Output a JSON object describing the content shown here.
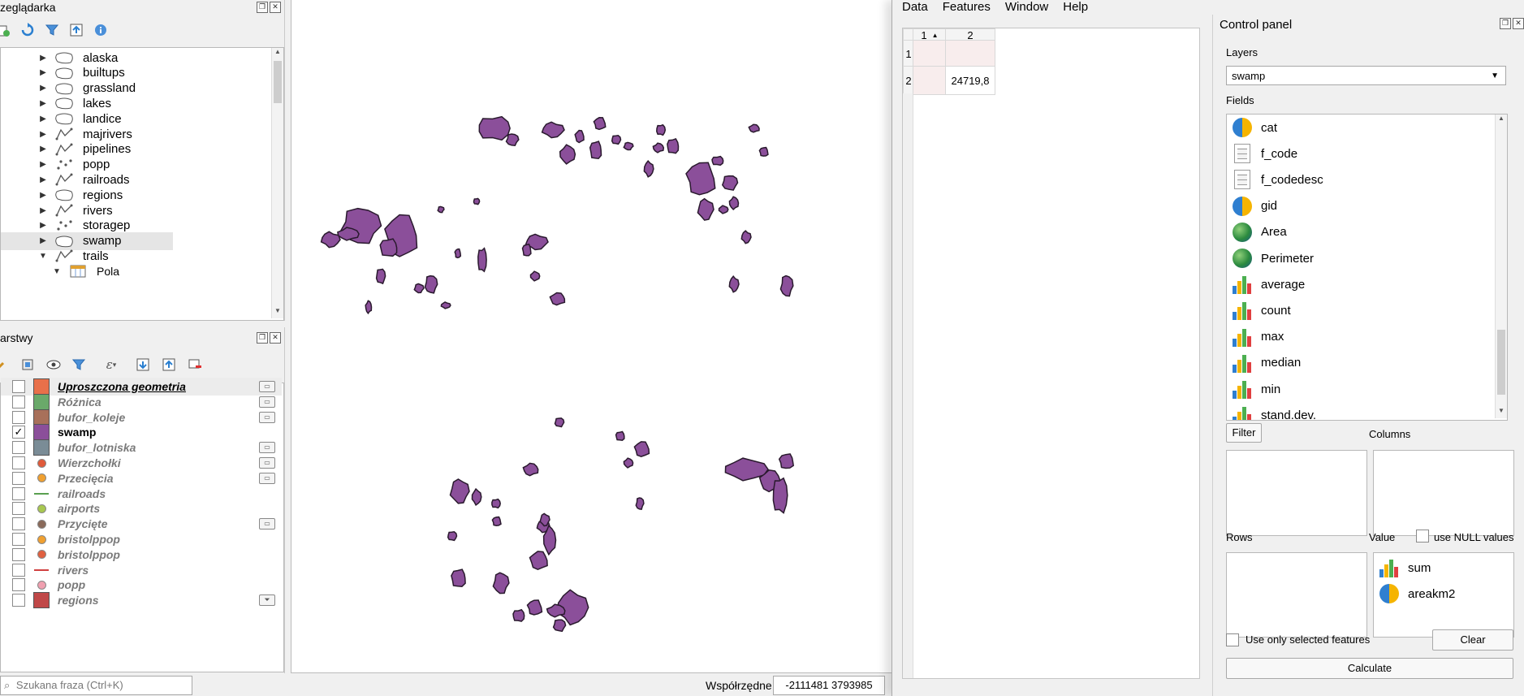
{
  "browser": {
    "title": "zeglądarka",
    "items": [
      {
        "label": "alaska",
        "icon": "polygon-layer-icon",
        "expanded": false
      },
      {
        "label": "builtups",
        "icon": "polygon-layer-icon",
        "expanded": false
      },
      {
        "label": "grassland",
        "icon": "polygon-layer-icon",
        "expanded": false
      },
      {
        "label": "lakes",
        "icon": "polygon-layer-icon",
        "expanded": false
      },
      {
        "label": "landice",
        "icon": "polygon-layer-icon",
        "expanded": false
      },
      {
        "label": "majrivers",
        "icon": "line-layer-icon",
        "expanded": false
      },
      {
        "label": "pipelines",
        "icon": "line-layer-icon",
        "expanded": false
      },
      {
        "label": "popp",
        "icon": "point-layer-icon",
        "expanded": false
      },
      {
        "label": "railroads",
        "icon": "line-layer-icon",
        "expanded": false
      },
      {
        "label": "regions",
        "icon": "polygon-layer-icon",
        "expanded": false
      },
      {
        "label": "rivers",
        "icon": "line-layer-icon",
        "expanded": false
      },
      {
        "label": "storagep",
        "icon": "point-layer-icon",
        "expanded": false
      },
      {
        "label": "swamp",
        "icon": "polygon-layer-icon",
        "expanded": false,
        "selected": true
      },
      {
        "label": "trails",
        "icon": "line-layer-icon",
        "expanded": true
      },
      {
        "label": "Pola",
        "icon": "table-icon",
        "expanded": true,
        "child": true
      }
    ]
  },
  "layers": {
    "title": "arstwy",
    "items": [
      {
        "label": "Uproszczona geometria",
        "symbol": "box",
        "color": "#e8704a",
        "checked": false,
        "indicator": true
      },
      {
        "label": "Różnica",
        "symbol": "box",
        "color": "#6aa96a",
        "checked": false,
        "indicator": true
      },
      {
        "label": "bufor_koleje",
        "symbol": "box",
        "color": "#a8705a",
        "checked": false,
        "indicator": true
      },
      {
        "label": "swamp",
        "symbol": "box",
        "color": "#8b4f9a",
        "checked": true,
        "indicator": false
      },
      {
        "label": "bufor_lotniska",
        "symbol": "box",
        "color": "#7a8c96",
        "checked": false,
        "indicator": true
      },
      {
        "label": "Wierzchołki",
        "symbol": "dot",
        "color": "#e05a3a",
        "checked": false,
        "indicator": true
      },
      {
        "label": "Przecięcia",
        "symbol": "dot",
        "color": "#f0a030",
        "checked": false,
        "indicator": true
      },
      {
        "label": "railroads",
        "symbol": "line",
        "color": "#5aa050",
        "checked": false,
        "indicator": false
      },
      {
        "label": "airports",
        "symbol": "dot",
        "color": "#a8c850",
        "checked": false,
        "indicator": false
      },
      {
        "label": "Przycięte",
        "symbol": "dot",
        "color": "#8a6a5a",
        "checked": false,
        "indicator": true
      },
      {
        "label": "bristolppop",
        "symbol": "dot",
        "color": "#f0a030",
        "checked": false,
        "indicator": false
      },
      {
        "label": "bristolppop",
        "symbol": "dot",
        "color": "#e06040",
        "checked": false,
        "indicator": false
      },
      {
        "label": "rivers",
        "symbol": "line",
        "color": "#d04040",
        "checked": false,
        "indicator": false
      },
      {
        "label": "popp",
        "symbol": "dot",
        "color": "#f0a0b0",
        "checked": false,
        "indicator": false
      },
      {
        "label": "regions",
        "symbol": "box",
        "color": "#c04848",
        "checked": false,
        "indicator": "filter"
      }
    ]
  },
  "status": {
    "search_placeholder": "Szukana fraza (Ctrl+K)",
    "coords_label": "Współrzędne",
    "coords_value": "-2111481  3793985"
  },
  "plot_window": {
    "menu": [
      "Data",
      "Features",
      "Window",
      "Help"
    ],
    "table": {
      "col_headers": [
        "1",
        "2"
      ],
      "row_headers": [
        "1",
        "2"
      ],
      "cells": [
        [
          "",
          ""
        ],
        [
          "",
          "24719,8"
        ]
      ]
    },
    "control_panel": {
      "title": "Control panel",
      "layers_label": "Layers",
      "layer_value": "swamp",
      "fields_label": "Fields",
      "fields": [
        {
          "label": "cat",
          "icon": "pie"
        },
        {
          "label": "f_code",
          "icon": "doc"
        },
        {
          "label": "f_codedesc",
          "icon": "doc"
        },
        {
          "label": "gid",
          "icon": "pie"
        },
        {
          "label": "Area",
          "icon": "globe"
        },
        {
          "label": "Perimeter",
          "icon": "globe"
        },
        {
          "label": "average",
          "icon": "bars"
        },
        {
          "label": "count",
          "icon": "bars"
        },
        {
          "label": "max",
          "icon": "bars"
        },
        {
          "label": "median",
          "icon": "bars"
        },
        {
          "label": "min",
          "icon": "bars"
        },
        {
          "label": "stand.dev.",
          "icon": "bars"
        }
      ],
      "filter_button": "Filter",
      "columns_label": "Columns",
      "rows_label": "Rows",
      "value_label": "Value",
      "use_null_label": "use NULL values",
      "value_items": [
        {
          "label": "sum",
          "icon": "bars"
        },
        {
          "label": "areakm2",
          "icon": "pie"
        }
      ],
      "selected_only_label": "Use only selected features",
      "clear_button": "Clear",
      "calculate_button": "Calculate"
    }
  },
  "colors": {
    "swamp_fill": "#8b4f9a",
    "swamp_stroke": "#2a1a2e"
  }
}
